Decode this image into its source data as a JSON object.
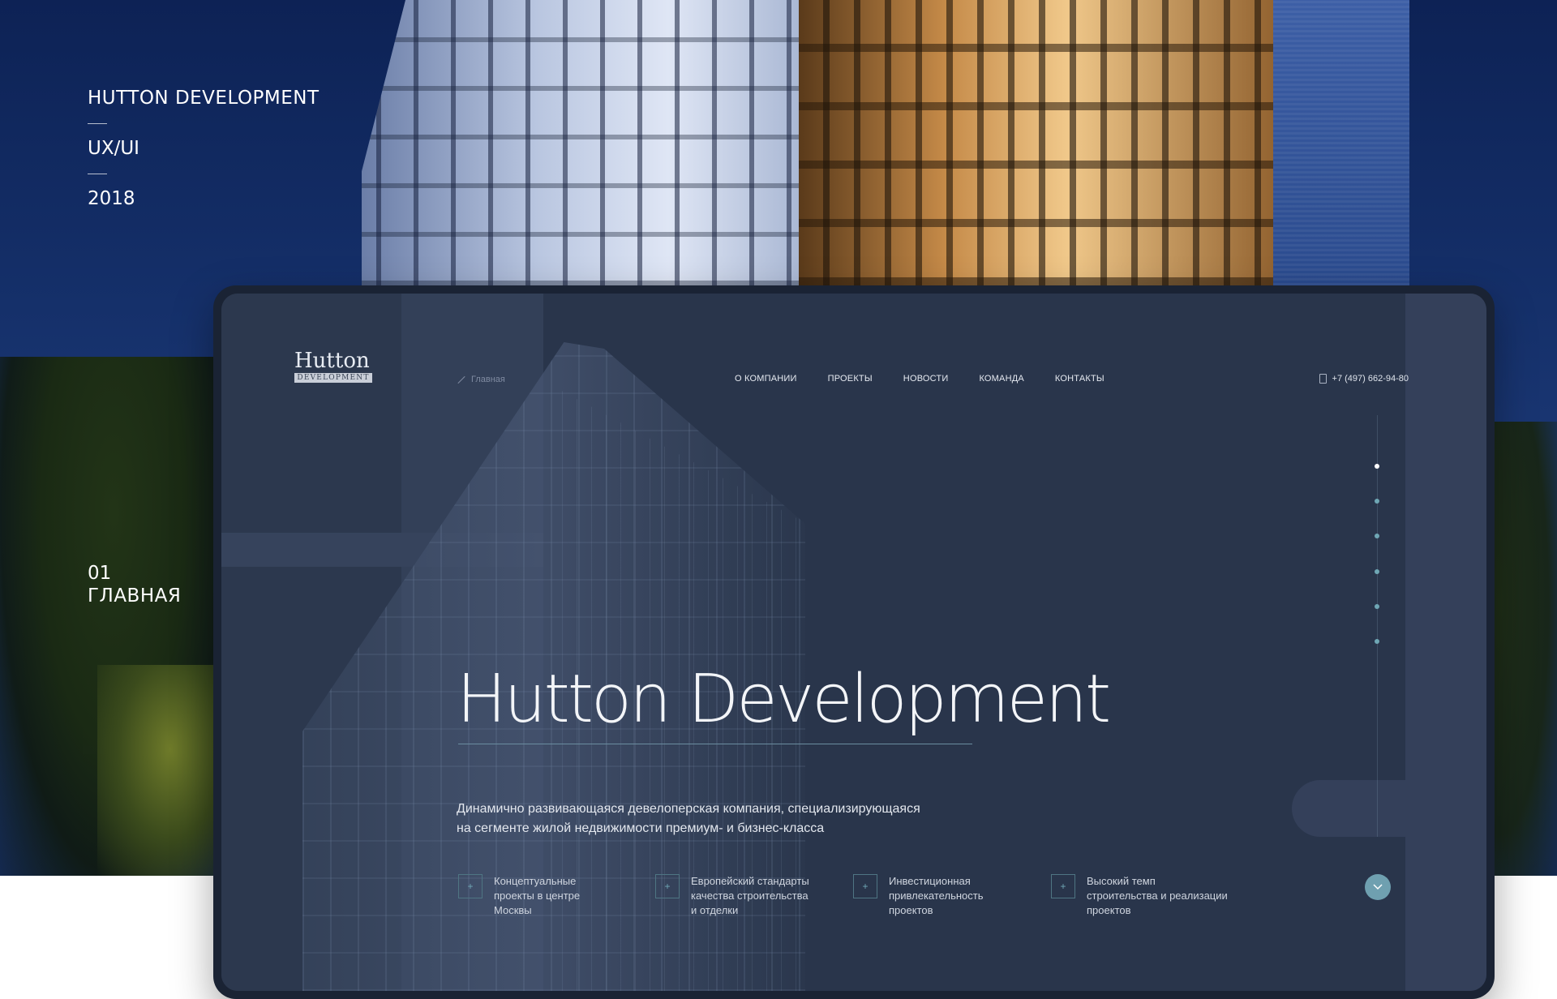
{
  "meta": {
    "project": "HUTTON DEVELOPMENT",
    "discipline": "UX/UI",
    "year": "2018",
    "page_number": "01",
    "page_title": "ГЛАВНАЯ"
  },
  "header": {
    "logo_top": "Hutton",
    "logo_bottom": "DEVELOPMENT",
    "breadcrumb": "Главная",
    "nav": [
      "О КОМПАНИИ",
      "ПРОЕКТЫ",
      "НОВОСТИ",
      "КОМАНДА",
      "КОНТАКТЫ"
    ],
    "phone": "+7 (497) 662-94-80"
  },
  "hero": {
    "title": "Hutton Development",
    "description_line1": "Динамично развивающаяся девелоперская компания, специализирующаяся",
    "description_line2": "на сегменте жилой недвижимости премиум- и бизнес-класса"
  },
  "features": [
    {
      "icon": "+",
      "text": "Концептуальные\nпроекты в центре\nМосквы"
    },
    {
      "icon": "+",
      "text": "Европейский стандарты\nкачества строительства\nи отделки"
    },
    {
      "icon": "+",
      "text": "Инвестиционная\nпривлекательность\nпроектов"
    },
    {
      "icon": "+",
      "text": "Высокий темп\nстроительства  и реализации\nпроектов"
    }
  ],
  "slider": {
    "total": 6,
    "active": 1
  },
  "colors": {
    "accent": "#6fa7b5",
    "screen_bg": "#29354b",
    "sky": "#15306a"
  }
}
